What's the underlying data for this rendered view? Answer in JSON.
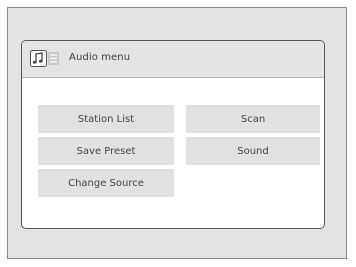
{
  "header": {
    "title": "Audio menu",
    "icon": "audio-source-icon"
  },
  "menu": {
    "items": [
      {
        "label": "Station List"
      },
      {
        "label": "Scan"
      },
      {
        "label": "Save Preset"
      },
      {
        "label": "Sound"
      },
      {
        "label": "Change Source"
      }
    ]
  },
  "colors": {
    "frame": "#e3e3e3",
    "screen": "#ffffff",
    "button": "#e1e1e1",
    "text": "#444444"
  }
}
